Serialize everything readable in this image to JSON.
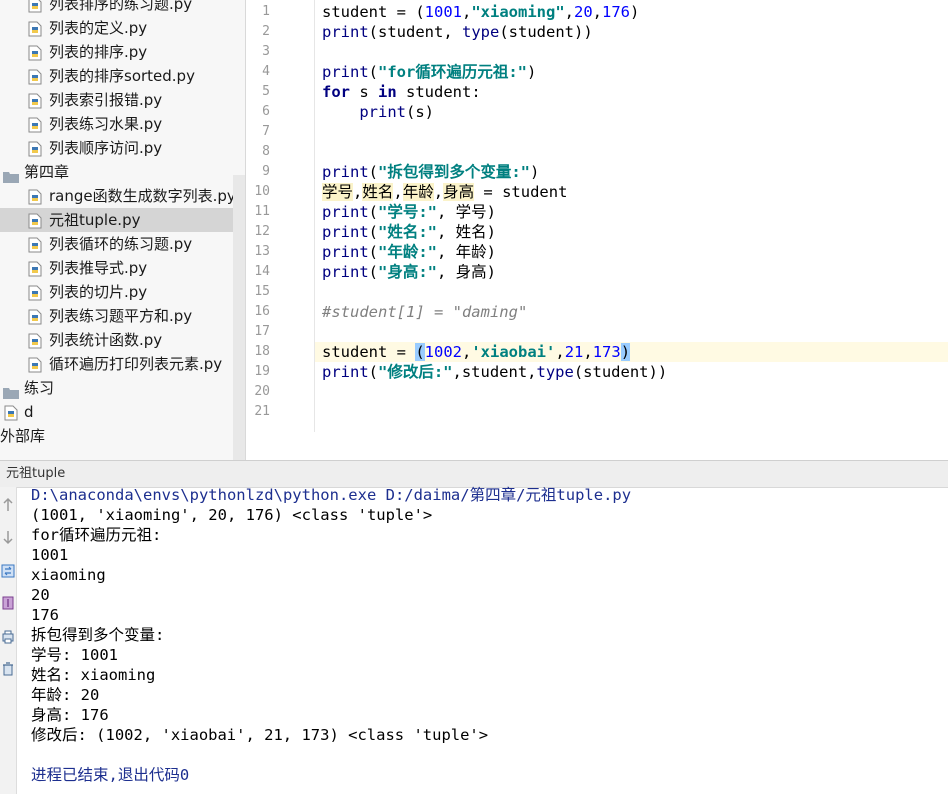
{
  "project_tree": {
    "items": [
      {
        "label": "列表排序的练习题.py",
        "type": "file"
      },
      {
        "label": "列表的定义.py",
        "type": "file"
      },
      {
        "label": "列表的排序.py",
        "type": "file"
      },
      {
        "label": "列表的排序sorted.py",
        "type": "file"
      },
      {
        "label": "列表索引报错.py",
        "type": "file"
      },
      {
        "label": "列表练习水果.py",
        "type": "file"
      },
      {
        "label": "列表顺序访问.py",
        "type": "file"
      },
      {
        "label": "第四章",
        "type": "folder"
      },
      {
        "label": "range函数生成数字列表.py",
        "type": "file"
      },
      {
        "label": "元祖tuple.py",
        "type": "file",
        "selected": true
      },
      {
        "label": "列表循环的练习题.py",
        "type": "file"
      },
      {
        "label": "列表推导式.py",
        "type": "file"
      },
      {
        "label": "列表的切片.py",
        "type": "file"
      },
      {
        "label": "列表练习题平方和.py",
        "type": "file"
      },
      {
        "label": "列表统计函数.py",
        "type": "file"
      },
      {
        "label": "循环遍历打印列表元素.py",
        "type": "file"
      },
      {
        "label": "练习",
        "type": "folder"
      },
      {
        "label": "d",
        "type": "file"
      },
      {
        "label": "外部库",
        "type": "library"
      }
    ]
  },
  "editor": {
    "line_numbers": [
      "1",
      "2",
      "3",
      "4",
      "5",
      "6",
      "7",
      "8",
      "9",
      "10",
      "11",
      "12",
      "13",
      "14",
      "15",
      "16",
      "17",
      "18",
      "19",
      "20",
      "21"
    ],
    "current_line": "18",
    "lines": [
      [
        {
          "t": "student = (",
          "c": ""
        },
        {
          "t": "1001",
          "c": "num"
        },
        {
          "t": ",",
          "c": ""
        },
        {
          "t": "\"xiaoming\"",
          "c": "str"
        },
        {
          "t": ",",
          "c": ""
        },
        {
          "t": "20",
          "c": "num"
        },
        {
          "t": ",",
          "c": ""
        },
        {
          "t": "176",
          "c": "num"
        },
        {
          "t": ")",
          "c": ""
        }
      ],
      [
        {
          "t": "print",
          "c": "fn"
        },
        {
          "t": "(student, ",
          "c": ""
        },
        {
          "t": "type",
          "c": "fn"
        },
        {
          "t": "(student))",
          "c": ""
        }
      ],
      [],
      [
        {
          "t": "print",
          "c": "fn"
        },
        {
          "t": "(",
          "c": ""
        },
        {
          "t": "\"for循环遍历元祖:\"",
          "c": "str"
        },
        {
          "t": ")",
          "c": ""
        }
      ],
      [
        {
          "t": "for",
          "c": "kw"
        },
        {
          "t": " s ",
          "c": ""
        },
        {
          "t": "in",
          "c": "kw"
        },
        {
          "t": " student:",
          "c": ""
        }
      ],
      [
        {
          "t": "    ",
          "c": ""
        },
        {
          "t": "print",
          "c": "fn"
        },
        {
          "t": "(s)",
          "c": ""
        }
      ],
      [],
      [],
      [
        {
          "t": "print",
          "c": "fn"
        },
        {
          "t": "(",
          "c": ""
        },
        {
          "t": "\"拆包得到多个变量:\"",
          "c": "str"
        },
        {
          "t": ")",
          "c": ""
        }
      ],
      [
        {
          "t": "学号",
          "c": "var-hl"
        },
        {
          "t": ",",
          "c": ""
        },
        {
          "t": "姓名",
          "c": "var-hl"
        },
        {
          "t": ",",
          "c": ""
        },
        {
          "t": "年龄",
          "c": "var-hl"
        },
        {
          "t": ",",
          "c": ""
        },
        {
          "t": "身高",
          "c": "var-hl"
        },
        {
          "t": " = student",
          "c": ""
        }
      ],
      [
        {
          "t": "print",
          "c": "fn"
        },
        {
          "t": "(",
          "c": ""
        },
        {
          "t": "\"学号:\"",
          "c": "str"
        },
        {
          "t": ", 学号)",
          "c": ""
        }
      ],
      [
        {
          "t": "print",
          "c": "fn"
        },
        {
          "t": "(",
          "c": ""
        },
        {
          "t": "\"姓名:\"",
          "c": "str"
        },
        {
          "t": ", 姓名)",
          "c": ""
        }
      ],
      [
        {
          "t": "print",
          "c": "fn"
        },
        {
          "t": "(",
          "c": ""
        },
        {
          "t": "\"年龄:\"",
          "c": "str"
        },
        {
          "t": ", 年龄)",
          "c": ""
        }
      ],
      [
        {
          "t": "print",
          "c": "fn"
        },
        {
          "t": "(",
          "c": ""
        },
        {
          "t": "\"身高:\"",
          "c": "str"
        },
        {
          "t": ", 身高)",
          "c": ""
        }
      ],
      [],
      [
        {
          "t": "#student[1] = \"daming\"",
          "c": "cm"
        }
      ],
      [],
      [
        {
          "t": "student = ",
          "c": ""
        },
        {
          "t": "(",
          "c": "paren-hl"
        },
        {
          "t": "1002",
          "c": "num"
        },
        {
          "t": ",",
          "c": ""
        },
        {
          "t": "'xiaobai'",
          "c": "str"
        },
        {
          "t": ",",
          "c": ""
        },
        {
          "t": "21",
          "c": "num"
        },
        {
          "t": ",",
          "c": ""
        },
        {
          "t": "173",
          "c": "num"
        },
        {
          "t": ")",
          "c": "paren-hl"
        }
      ],
      [
        {
          "t": "print",
          "c": "fn"
        },
        {
          "t": "(",
          "c": ""
        },
        {
          "t": "\"修改后:\"",
          "c": "str"
        },
        {
          "t": ",student,",
          "c": ""
        },
        {
          "t": "type",
          "c": "fn"
        },
        {
          "t": "(student))",
          "c": ""
        }
      ],
      [],
      []
    ]
  },
  "run_panel": {
    "tab_title": "元祖tuple",
    "command": "D:\\anaconda\\envs\\pythonlzd\\python.exe D:/daima/第四章/元祖tuple.py",
    "output_lines": [
      "(1001, 'xiaoming', 20, 176) <class 'tuple'>",
      "for循环遍历元祖:",
      "1001",
      "xiaoming",
      "20",
      "176",
      "拆包得到多个变量:",
      "学号: 1001",
      "姓名: xiaoming",
      "年龄: 20",
      "身高: 176",
      "修改后: (1002, 'xiaobai', 21, 173) <class 'tuple'>",
      ""
    ],
    "exit_message": "进程已结束,退出代码0",
    "toolbar_icons": [
      "up-arrow-icon",
      "down-arrow-icon",
      "rerun-icon",
      "pin-icon",
      "print-icon",
      "trash-icon"
    ]
  },
  "colors": {
    "keyword": "#000080",
    "string": "#008080",
    "number": "#0000ff",
    "comment": "#808080",
    "console_cmd": "#1d2f8f"
  }
}
